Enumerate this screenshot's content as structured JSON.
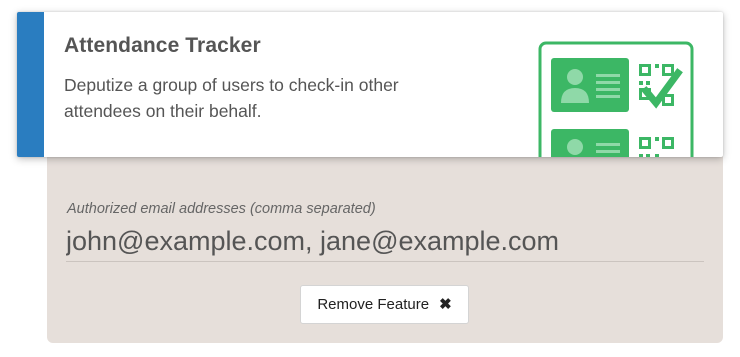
{
  "feature": {
    "title": "Attendance Tracker",
    "description": "Deputize a group of users to check-in other attendees on their behalf.",
    "accent_color": "#2a7dc0",
    "illustration_color": "#3cb765",
    "illustration_icon": "id-card-qr-checkmark-icon"
  },
  "form": {
    "label": "Authorized email addresses (comma separated)",
    "value": "john@example.com, jane@example.com"
  },
  "actions": {
    "remove_label": "Remove Feature",
    "remove_icon": "close-icon"
  }
}
